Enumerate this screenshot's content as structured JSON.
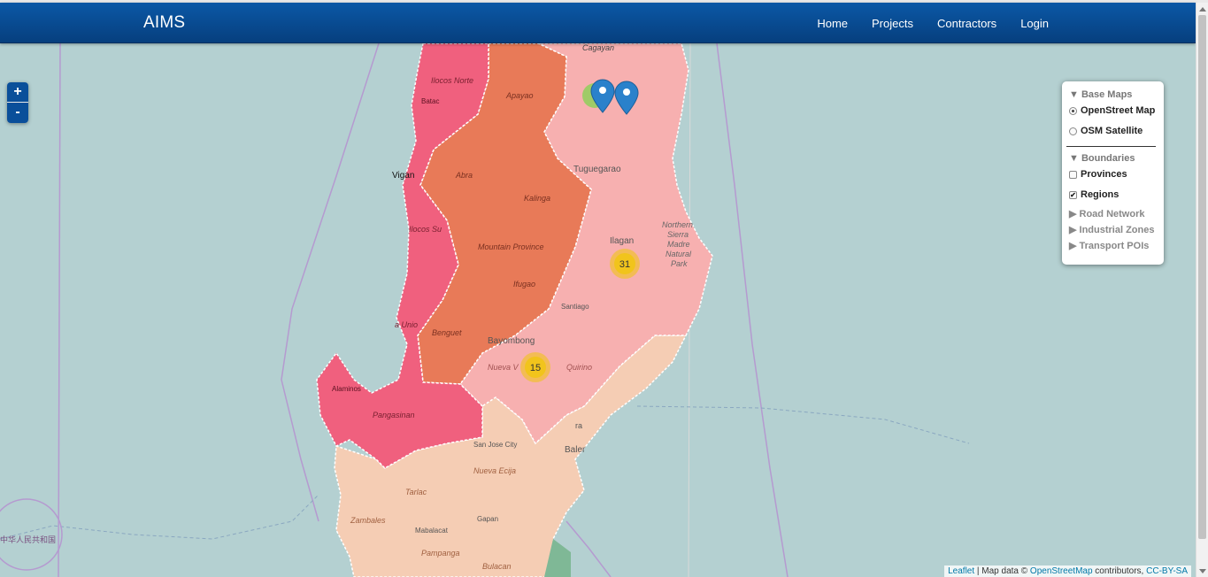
{
  "app": {
    "brand": "AIMS"
  },
  "nav": {
    "items": [
      "Home",
      "Projects",
      "Contractors",
      "Login"
    ]
  },
  "zoom": {
    "in_label": "+",
    "out_label": "-"
  },
  "layers": {
    "base_maps_title": "▼ Base Maps",
    "base_maps": [
      {
        "label": "OpenStreet Map",
        "selected": true
      },
      {
        "label": "OSM Satellite",
        "selected": false
      }
    ],
    "boundaries_title": "▼ Boundaries",
    "boundaries": [
      {
        "label": "Provinces",
        "checked": false
      },
      {
        "label": "Regions",
        "checked": true
      }
    ],
    "other_groups": [
      "▶ Road Network",
      "▶ Industrial Zones",
      "▶ Transport POIs"
    ]
  },
  "clusters": [
    {
      "count": "31"
    },
    {
      "count": "15"
    }
  ],
  "map_labels": {
    "cagayan": "Cagayan",
    "ilocos_norte": "Ilocos Norte",
    "apayao": "Apayao",
    "batac": "Batac",
    "vigan": "Vigan",
    "abra": "Abra",
    "tuguegarao": "Tuguegarao",
    "kalinga": "Kalinga",
    "ilocos_sur": "Ilocos Su",
    "ilagan": "Ilagan",
    "northern_sierra": [
      "Northern",
      "Sierra",
      "Madre",
      "Natural",
      "Park"
    ],
    "mountain_province": "Mountain Province",
    "ifugao": "Ifugao",
    "santiago": "Santiago",
    "la_union": "a Unio",
    "benguet": "Benguet",
    "bayombong": "Bayombong",
    "nueva_vizcaya": "Nueva V",
    "quirino": "Quirino",
    "alaminos": "Alaminos",
    "pangasinan": "Pangasinan",
    "san_jose_city": "San Jose City",
    "baler": "Baler",
    "nueva_ecija": "Nueva Ecija",
    "tarlac": "Tarlac",
    "zambales": "Zambales",
    "gapan": "Gapan",
    "mabalacat": "Mabalacat",
    "pampanga": "Pampanga",
    "bulacan": "Bulacan",
    "china": "中华人民共和国",
    "aurora": "ra"
  },
  "attribution": {
    "leaflet": "Leaflet",
    "middle": " | Map data © ",
    "osm": "OpenStreetMap",
    "contributors": " contributors, ",
    "license": "CC-BY-SA"
  },
  "colors": {
    "water": "#b4d0d1",
    "ilocos_region": "#f0607e",
    "cordillera": "#e87a58",
    "cagayan_valley": "#f7b0b0",
    "central_luzon": "#f5cdb4",
    "cluster": "#f0c419",
    "navbar": "#0b58a6"
  }
}
